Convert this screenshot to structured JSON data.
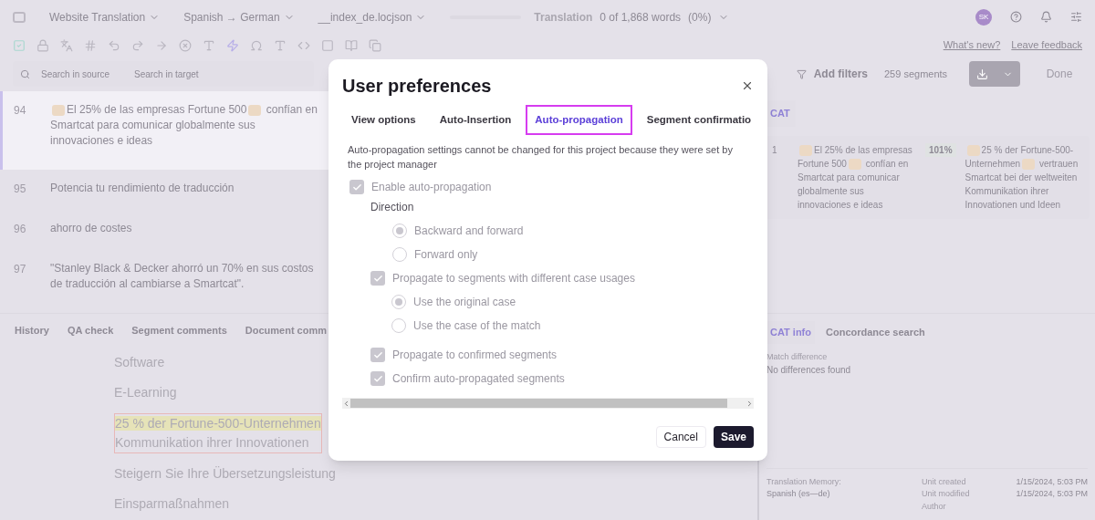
{
  "top_bar": {
    "project": "Website Translation",
    "languages": "Spanish → German",
    "file": "__index_de.locjson",
    "progress": {
      "level": 0
    },
    "stage": "Translation",
    "words": "0 of 1,868 words",
    "percent": "(0%)",
    "avatar": "SK"
  },
  "links": [
    "What's new?",
    "Leave feedback"
  ],
  "search": {
    "source_placeholder": "Search in source",
    "target_placeholder": "Search in target"
  },
  "filters": {
    "label": "Add filters",
    "count": "259 segments",
    "done": "Done"
  },
  "segments": [
    {
      "number": "94",
      "text": "El 25% de las empresas Fortune 500",
      "text_after": "confían en Smartcat para comunicar globalmente sus innovaciones e ideas",
      "tags": true,
      "selected": true
    },
    {
      "number": "95",
      "text": "Potencia tu rendimiento de traducción",
      "tags": false,
      "selected": false
    },
    {
      "number": "96",
      "text": "ahorro de costes",
      "tags": false,
      "selected": false
    },
    {
      "number": "97",
      "text": "\"Stanley Black & Decker ahorró un 70% en sus costos de traducción al cambiarse a Smartcat\".",
      "tags": false,
      "selected": false
    }
  ],
  "cat_panel": {
    "tab": "CAT",
    "match": {
      "number": "1",
      "source": "El 25% de las empresas Fortune 500",
      "source_after": "confían en Smartcat para comunicar globalmente sus innovaciones e ideas",
      "score": "101%",
      "target": "25 % der Fortune-500-Unternehmen",
      "target_after": "vertrauen Smartcat bei der weltweiten Kommunikation ihrer Innovationen und Ideen"
    }
  },
  "bottom_tabs": [
    {
      "label": "History",
      "selected": false
    },
    {
      "label": "QA check",
      "selected": false
    },
    {
      "label": "Segment comments",
      "selected": false
    },
    {
      "label": "Document comm",
      "selected": false
    }
  ],
  "preview": [
    {
      "text": "Software",
      "highlighted": false
    },
    {
      "text": "E-Learning",
      "highlighted": false
    },
    {
      "text": "25 % der Fortune-500-Unternehmen",
      "text_line2": "Kommunikation ihrer Innovationen",
      "highlighted": true
    },
    {
      "text": "Steigern Sie Ihre Übersetzungsleistung",
      "highlighted": false
    },
    {
      "text": "Einsparmaßnahmen",
      "highlighted": false
    }
  ],
  "info_tabs": [
    {
      "label": "CAT info",
      "selected": true
    },
    {
      "label": "Concordance search",
      "selected": false
    }
  ],
  "match_difference": {
    "label": "Match difference",
    "value": "No differences found"
  },
  "footer": {
    "tm_label": "Translation Memory:",
    "tm_value": "Spanish  (es—de)",
    "rows": [
      {
        "label": "Unit created",
        "value": "1/15/2024, 5:03 PM"
      },
      {
        "label": "Unit modified",
        "value": "1/15/2024, 5:03 PM"
      },
      {
        "label": "Author"
      }
    ]
  },
  "dialog": {
    "title": "User preferences",
    "tabs": [
      {
        "label": "View options",
        "selected": false
      },
      {
        "label": "Auto-Insertion",
        "selected": false
      },
      {
        "label": "Auto-propagation",
        "selected": true
      },
      {
        "label": "Segment confirmatio",
        "selected": false
      }
    ],
    "note": "Auto-propagation settings cannot be changed for this project because they were set by the project manager",
    "options": [
      {
        "kind": "checkbox",
        "label": "Enable auto-propagation",
        "checked": true,
        "disabled": true,
        "children": [
          {
            "kind": "heading",
            "label": "Direction",
            "children": [
              {
                "kind": "radio",
                "label": "Backward and forward",
                "selected": true,
                "disabled": true
              },
              {
                "kind": "radio",
                "label": "Forward only",
                "selected": false,
                "disabled": true
              }
            ]
          },
          {
            "kind": "checkbox",
            "label": "Propagate to segments with different case usages",
            "checked": true,
            "disabled": true,
            "children": [
              {
                "kind": "radio",
                "label": "Use the original case",
                "selected": true,
                "disabled": true
              },
              {
                "kind": "radio",
                "label": "Use the case of the match",
                "selected": false,
                "disabled": true
              }
            ]
          },
          {
            "kind": "checkbox",
            "label": "Propagate to confirmed segments",
            "checked": true,
            "disabled": true
          },
          {
            "kind": "checkbox",
            "label": "Confirm auto-propagated segments",
            "checked": true,
            "disabled": true
          }
        ]
      }
    ],
    "buttons": [
      "Cancel",
      "Save"
    ]
  }
}
